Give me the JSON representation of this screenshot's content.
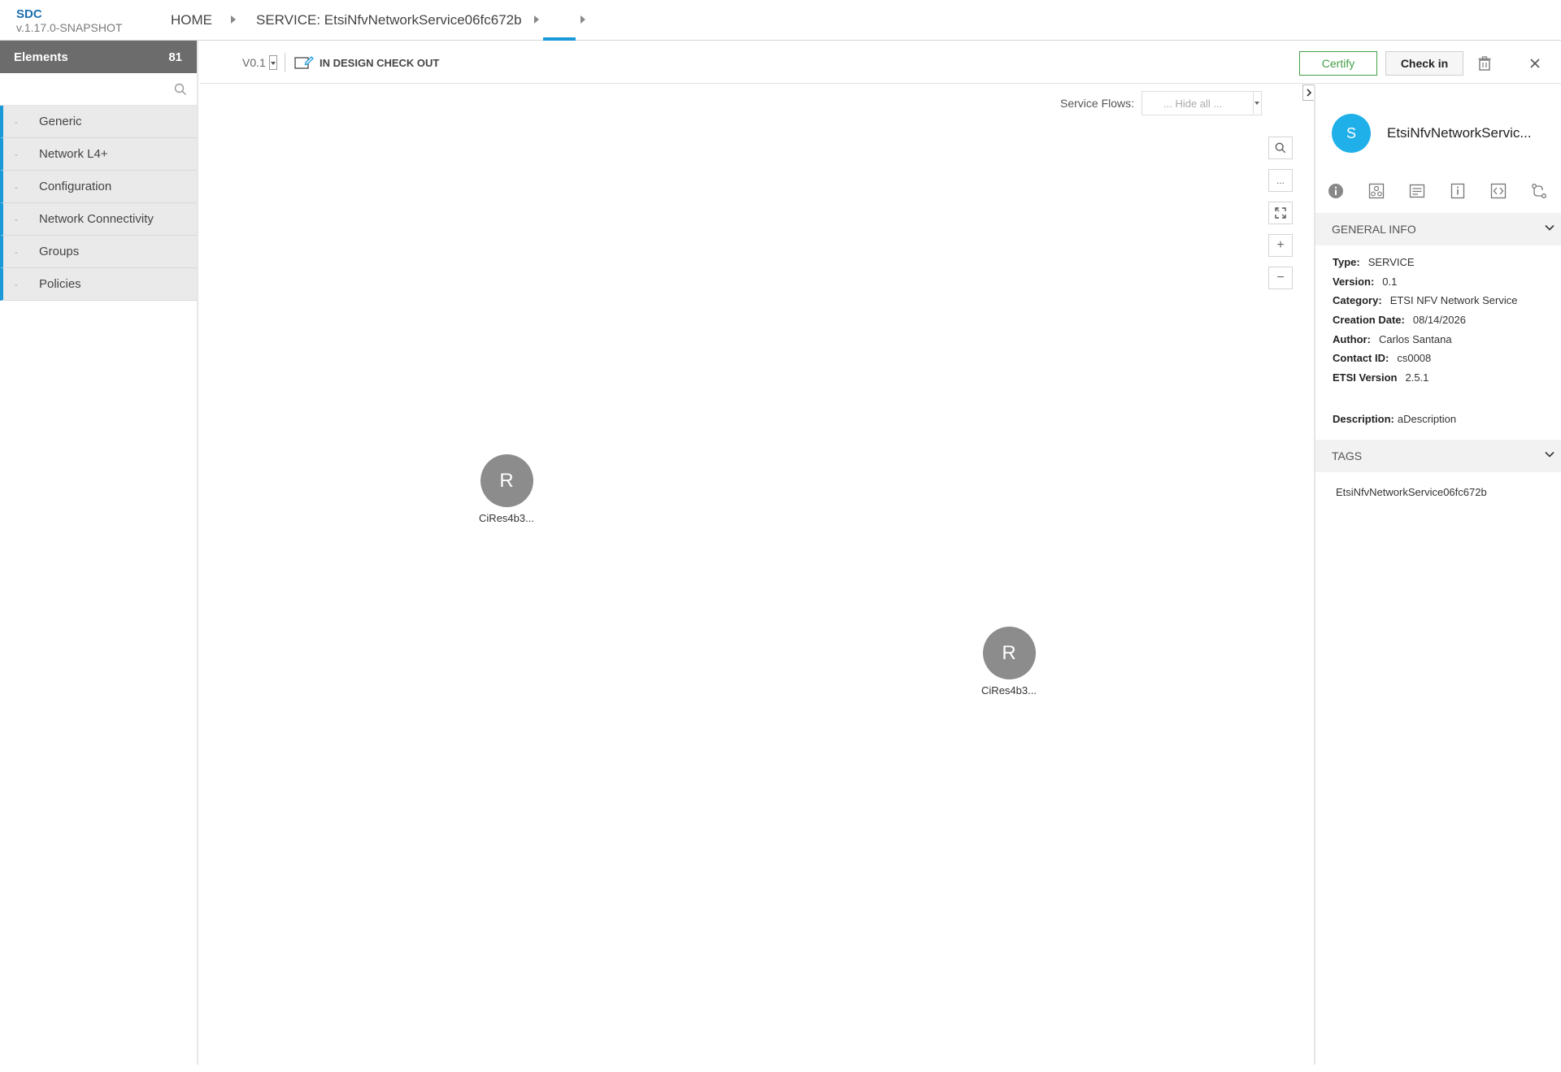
{
  "header": {
    "brand": "SDC",
    "version": "v.1.17.0-SNAPSHOT",
    "breadcrumb_home": "HOME",
    "breadcrumb_service": "SERVICE: EtsiNfvNetworkService06fc672b"
  },
  "palette": {
    "title": "Elements",
    "count": "81",
    "search_placeholder": "",
    "groups": [
      {
        "label": "Generic"
      },
      {
        "label": "Network L4+"
      },
      {
        "label": "Configuration"
      },
      {
        "label": "Network Connectivity"
      },
      {
        "label": "Groups"
      },
      {
        "label": "Policies"
      }
    ],
    "collapse_symbol": "-"
  },
  "toolbar": {
    "version": "V0.1",
    "status": "IN DESIGN CHECK OUT",
    "certify_label": "Certify",
    "checkin_label": "Check in"
  },
  "canvas": {
    "service_flows_label": "Service Flows:",
    "service_flows_value": "... Hide all ...",
    "zoom_more": "...",
    "zoom_in": "+",
    "zoom_out": "−",
    "nodes": [
      {
        "letter": "R",
        "label": "CiRes4b3..."
      },
      {
        "letter": "R",
        "label": "CiRes4b3..."
      }
    ]
  },
  "panel": {
    "avatar_letter": "S",
    "title": "EtsiNfvNetworkServic...",
    "general_info_title": "GENERAL INFO",
    "fields": {
      "type_label": "Type:",
      "type": "SERVICE",
      "version_label": "Version:",
      "version": "0.1",
      "category_label": "Category:",
      "category": "ETSI NFV Network Service",
      "creation_label": "Creation Date:",
      "creation": "08/14/2026",
      "author_label": "Author:",
      "author": "Carlos Santana",
      "contact_label": "Contact ID:",
      "contact": "cs0008",
      "etsi_label": "ETSI Version",
      "etsi": "2.5.1",
      "description_label": "Description:",
      "description": "aDescription"
    },
    "tags_title": "TAGS",
    "tag": "EtsiNfvNetworkService06fc672b"
  },
  "colors": {
    "accent": "#1a9ad9",
    "certify": "#43a047",
    "avatar": "#1fb0ea",
    "node": "#8c8c8c"
  }
}
